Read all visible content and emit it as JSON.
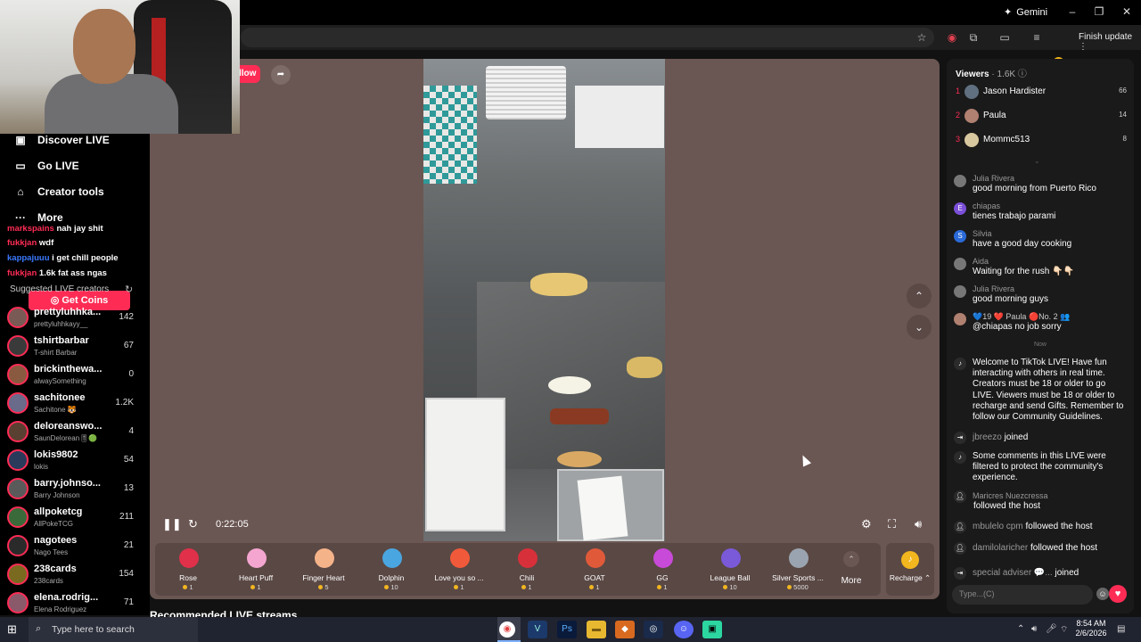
{
  "browser": {
    "gemini_label": "Gemini",
    "finish_update_label": "Finish update"
  },
  "sidebar": {
    "nav": [
      {
        "label": "Discover LIVE",
        "icon": "live-icon"
      },
      {
        "label": "Go LIVE",
        "icon": "camera-icon"
      },
      {
        "label": "Creator tools",
        "icon": "home-icon"
      },
      {
        "label": "More",
        "icon": "more-icon"
      }
    ],
    "overlay_chat": [
      {
        "name": "markspains",
        "text": "nah jay shit"
      },
      {
        "name": "fukkjan",
        "text": "wdf"
      },
      {
        "name": "kappajuuu",
        "text": "i get chill people"
      },
      {
        "name": "fukkjan",
        "text": "1.6k fat ass ngas"
      }
    ],
    "get_coins_label": "Get Coins",
    "suggested_title": "Suggested LIVE creators",
    "creators": [
      {
        "name": "prettyluhhka...",
        "sub": "prettyluhhkayy__",
        "count": "142",
        "color": "#7a5a55"
      },
      {
        "name": "tshirtbarbar",
        "sub": "T-shirt Barbar",
        "count": "67",
        "color": "#3a3a3a"
      },
      {
        "name": "brickinthewa...",
        "sub": "alwaySomething",
        "count": "0",
        "color": "#8a5a40"
      },
      {
        "name": "sachitonee",
        "sub": "Sachitone 🐯",
        "count": "1.2K",
        "color": "#6a6a8a"
      },
      {
        "name": "deloreanswo...",
        "sub": "SaunDelorean🎚🟢",
        "count": "4",
        "color": "#5a4030"
      },
      {
        "name": "lokis9802",
        "sub": "lokis",
        "count": "54",
        "color": "#2a3a5a"
      },
      {
        "name": "barry.johnso...",
        "sub": "Barry Johnson",
        "count": "13",
        "color": "#5a5a5a"
      },
      {
        "name": "allpoketcg",
        "sub": "AllPokeTCG",
        "count": "211",
        "color": "#3a6a3a"
      },
      {
        "name": "nagotees",
        "sub": "Nago Tees",
        "count": "21",
        "color": "#2a2a2a"
      },
      {
        "name": "238cards",
        "sub": "238cards",
        "count": "154",
        "color": "#7a6a20"
      },
      {
        "name": "elena.rodrig...",
        "sub": "Elena Rodriguez",
        "count": "71",
        "color": "#8a5a6a"
      }
    ]
  },
  "stage": {
    "follow_label": "llow",
    "time": "0:22:05"
  },
  "gifts": [
    {
      "name": "Rose",
      "price": "1",
      "color": "#e0304a"
    },
    {
      "name": "Heart Puff",
      "price": "1",
      "color": "#f4a6d0"
    },
    {
      "name": "Finger Heart",
      "price": "5",
      "color": "#f5b38a"
    },
    {
      "name": "Dolphin",
      "price": "10",
      "color": "#4aa6e0"
    },
    {
      "name": "Love you so ...",
      "price": "1",
      "color": "#f05a3a"
    },
    {
      "name": "Chili",
      "price": "1",
      "color": "#d8303a"
    },
    {
      "name": "GOAT",
      "price": "1",
      "color": "#e05a3a"
    },
    {
      "name": "GG",
      "price": "1",
      "color": "#c84ad8"
    },
    {
      "name": "League Ball",
      "price": "10",
      "color": "#7a5ad8"
    },
    {
      "name": "Silver Sports ...",
      "price": "5000",
      "color": "#9aa4b0"
    }
  ],
  "more_label": "More",
  "recharge_label": "Recharge ⌃",
  "recommended_title": "Recommended LIVE streams",
  "panel": {
    "viewers_label": "Viewers",
    "viewers_count": "· 1.6K",
    "top_viewers": [
      {
        "rank": "1",
        "name": "Jason Hardister",
        "score": "66",
        "color": "#607080"
      },
      {
        "rank": "2",
        "name": "Paula",
        "score": "14",
        "color": "#b08070"
      },
      {
        "rank": "3",
        "name": "Mommc513",
        "score": "8",
        "color": "#d8c8a0"
      }
    ],
    "messages": [
      {
        "name": "Julia Rivera",
        "text": "good morning from Puerto Rico",
        "color": "#777",
        "initial": ""
      },
      {
        "name": "chiapas",
        "text": "tienes trabajo parami",
        "color": "#7b4fd8",
        "initial": "E"
      },
      {
        "name": "Silvia",
        "text": "have a good day cooking",
        "color": "#2a6ad8",
        "initial": "S"
      },
      {
        "name": "Aida",
        "text": "Waiting for the rush 👇🏻👇🏻",
        "color": "#777",
        "initial": ""
      },
      {
        "name": "Julia Rivera",
        "text": "good morning guys",
        "color": "#777",
        "initial": ""
      },
      {
        "name": "💙19 ❤️ Paula 🔴No. 2 👥",
        "text": "@chiapas no job sorry",
        "color": "#b08070",
        "initial": ""
      }
    ],
    "now_label": "Now",
    "system_message": "Welcome to TikTok LIVE! Have fun interacting with others in real time. Creators must be 18 or older to go LIVE. Viewers must be 18 or older to recharge and send Gifts. Remember to follow our Community Guidelines.",
    "joined_1": {
      "name": "jbreezo",
      "action": "joined"
    },
    "filtered_message": "Some comments in this LIVE were filtered to protect the community's experience.",
    "followed_1": {
      "name": "Maricres Nuezcressa",
      "action": "followed the host"
    },
    "followed_2": {
      "name": "mbulelo cpm",
      "action": "followed the host"
    },
    "followed_3": {
      "name": "damilolaricher",
      "action": "followed the host"
    },
    "joined_2": {
      "name": "special adviser 💬...",
      "action": "joined"
    },
    "input_placeholder": "Type...(C)"
  },
  "taskbar": {
    "search_placeholder": "Type here to search",
    "time": "8:54 AM",
    "date": "2/6/2026"
  }
}
